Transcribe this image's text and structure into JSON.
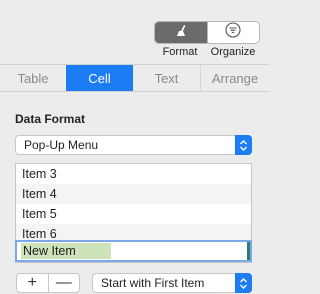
{
  "toolbar": {
    "format_label": "Format",
    "organize_label": "Organize",
    "format_icon": "paintbrush-icon",
    "organize_icon": "filter-icon"
  },
  "tabs": [
    {
      "label": "Table",
      "active": false
    },
    {
      "label": "Cell",
      "active": true
    },
    {
      "label": "Text",
      "active": false
    },
    {
      "label": "Arrange",
      "active": false
    }
  ],
  "data_format": {
    "title": "Data Format",
    "selected": "Pop-Up Menu"
  },
  "popup_items": [
    "Item 3",
    "Item 4",
    "Item 5",
    "Item 6"
  ],
  "new_item": {
    "value": "New Item"
  },
  "controls": {
    "add_label": "+",
    "remove_label": "—",
    "start_selected": "Start with First Item"
  },
  "colors": {
    "accent": "#1b7cf4",
    "selection_highlight": "#cfe3b8"
  }
}
